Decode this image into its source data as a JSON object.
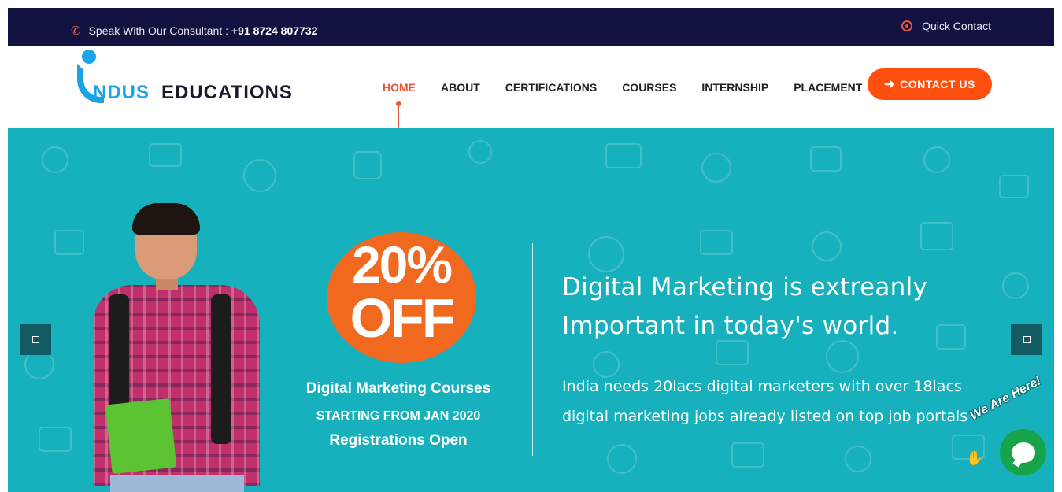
{
  "topbar": {
    "consult_label": "Speak With Our Consultant :",
    "consult_phone": "+91 8724 807732",
    "quick_contact": "Quick Contact"
  },
  "logo": {
    "part1": "NDUS",
    "part2": "EDUCATIONS"
  },
  "nav": {
    "items": [
      {
        "label": "HOME",
        "active": true
      },
      {
        "label": "ABOUT",
        "active": false
      },
      {
        "label": "CERTIFICATIONS",
        "active": false
      },
      {
        "label": "COURSES",
        "active": false
      },
      {
        "label": "INTERNSHIP",
        "active": false
      },
      {
        "label": "PLACEMENT",
        "active": false
      }
    ],
    "cta_label": "CONTACT US"
  },
  "hero": {
    "badge_percent": "20%",
    "badge_off": "OFF",
    "course_title": "Digital Marketing Courses",
    "course_start": "STARTING FROM JAN 2020",
    "course_reg": "Registrations Open",
    "headline_line1": "Digital Marketing is extreanly",
    "headline_line2": "Important in today's world.",
    "sub_line1": "India needs 20lacs digital marketers with over 18lacs",
    "sub_line2": "digital marketing jobs already listed on top job portals"
  },
  "chat": {
    "label": "We Are Here!"
  },
  "colors": {
    "topbar_bg": "#11123f",
    "accent": "#ff4f0f",
    "hero_bg": "#17b1bd",
    "logo_blue": "#1aa3e8",
    "chat_green": "#17a34a"
  },
  "icons": {
    "phone": "phone-icon",
    "quick_contact": "globe-icon",
    "cta": "arrow-right-icon",
    "slider_prev": "square-icon",
    "slider_next": "square-icon",
    "chat": "chat-bubble-icon",
    "wave": "waving-hand-icon"
  }
}
